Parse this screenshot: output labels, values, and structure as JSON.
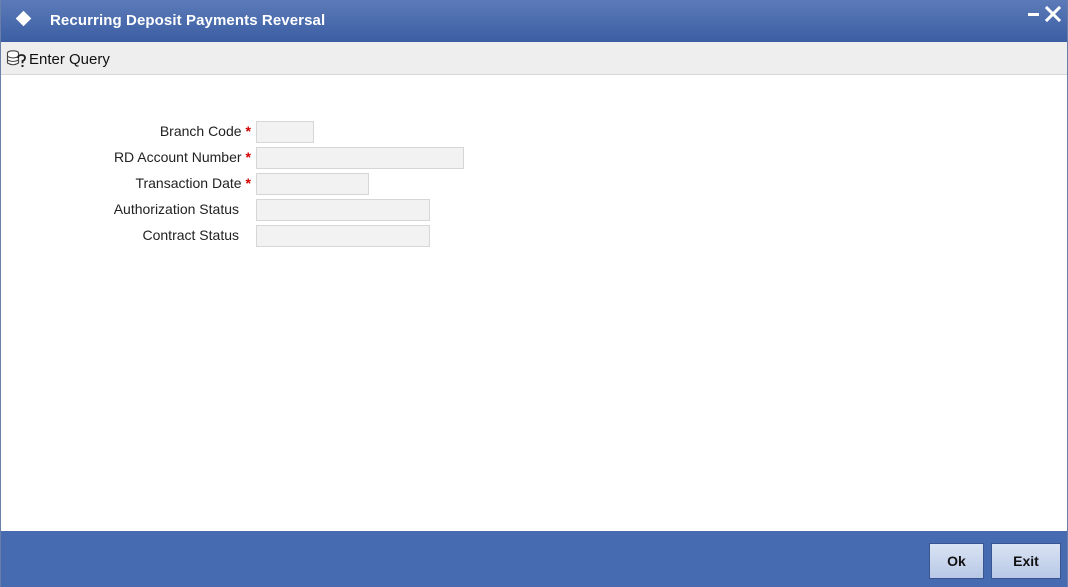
{
  "window": {
    "title": "Recurring Deposit Payments Reversal"
  },
  "toolbar": {
    "enter_query_label": "Enter Query"
  },
  "form": {
    "fields": [
      {
        "label": "Branch Code",
        "required": true,
        "value": ""
      },
      {
        "label": "RD Account Number",
        "required": true,
        "value": ""
      },
      {
        "label": "Transaction Date",
        "required": true,
        "value": ""
      },
      {
        "label": "Authorization Status",
        "required": false,
        "value": ""
      },
      {
        "label": "Contract Status",
        "required": false,
        "value": ""
      }
    ],
    "required_marker": "*"
  },
  "footer": {
    "ok_label": "Ok",
    "exit_label": "Exit"
  },
  "colors": {
    "titlebar": "#3b5ea3",
    "footer": "#476bb0",
    "required": "#d40000"
  },
  "icons": {
    "title": "diamond-icon",
    "minimize": "minimize-icon",
    "close": "close-icon",
    "query": "enter-query-icon"
  }
}
